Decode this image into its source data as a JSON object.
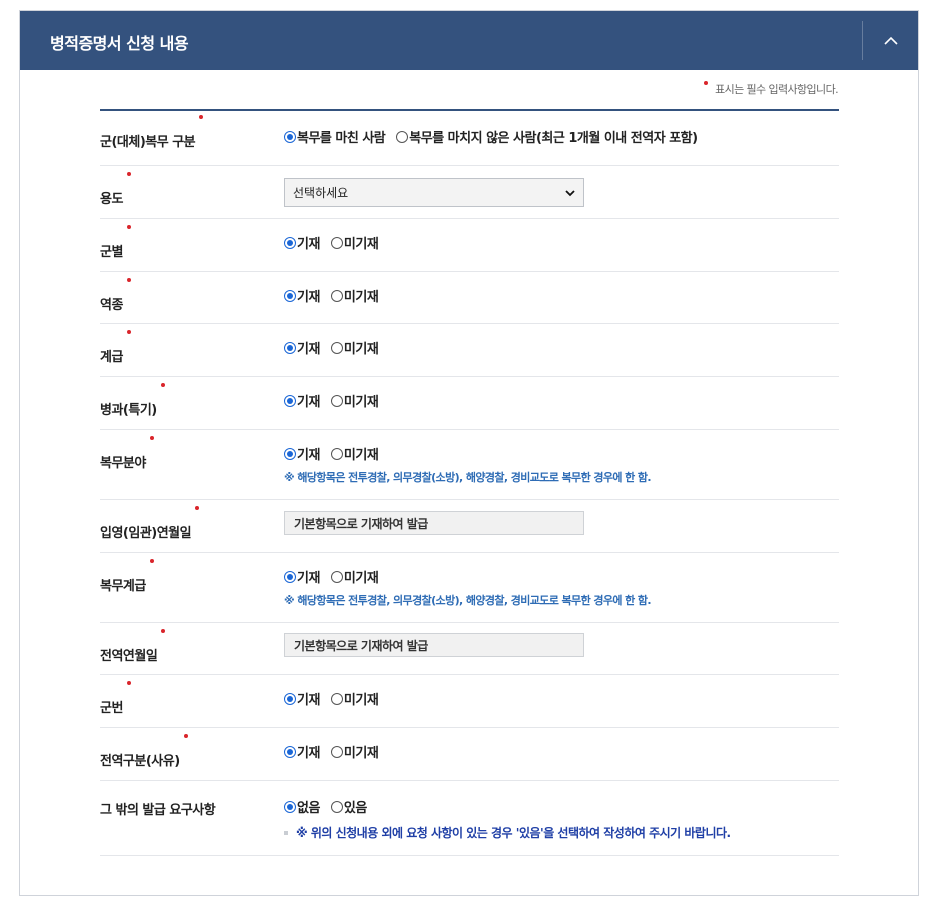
{
  "panel": {
    "title": "병적증명서 신청 내용",
    "collapse_icon": "chevron-up-icon"
  },
  "required_note": "표시는 필수 입력사항입니다.",
  "colors": {
    "header_bg": "#34527e",
    "required_dot": "#d9252b",
    "radio_checked": "#1a66d6",
    "hint": "#2e6cb5"
  },
  "rows": {
    "service_type": {
      "label": "군(대체)복무 구분",
      "opt1": "복무를 마친 사람",
      "opt2": "복무를 마치지 않은 사람(최근 1개월 이내 전역자 포함)"
    },
    "purpose": {
      "label": "용도",
      "select_value": "선택하세요"
    },
    "branch": {
      "label": "군별",
      "opt1": "기재",
      "opt2": "미기재"
    },
    "service_category": {
      "label": "역종",
      "opt1": "기재",
      "opt2": "미기재"
    },
    "rank": {
      "label": "계급",
      "opt1": "기재",
      "opt2": "미기재"
    },
    "specialty": {
      "label": "병과(특기)",
      "opt1": "기재",
      "opt2": "미기재"
    },
    "service_field": {
      "label": "복무분야",
      "opt1": "기재",
      "opt2": "미기재",
      "hint": "※ 해당항목은 전투경찰, 의무경찰(소방), 해양경찰, 경비교도로 복무한 경우에 한 함."
    },
    "enlist_date": {
      "label": "입영(임관)연월일",
      "value": "기본항목으로 기재하여 발급"
    },
    "service_rank": {
      "label": "복무계급",
      "opt1": "기재",
      "opt2": "미기재",
      "hint": "※ 해당항목은 전투경찰, 의무경찰(소방), 해양경찰, 경비교도로 복무한 경우에 한 함."
    },
    "discharge_date": {
      "label": "전역연월일",
      "value": "기본항목으로 기재하여 발급"
    },
    "service_number": {
      "label": "군번",
      "opt1": "기재",
      "opt2": "미기재"
    },
    "discharge_reason": {
      "label": "전역구분(사유)",
      "opt1": "기재",
      "opt2": "미기재"
    },
    "other_requests": {
      "label": "그 밖의 발급 요구사항",
      "opt1": "없음",
      "opt2": "있음",
      "hint": "※ 위의 신청내용 외에 요청 사항이 있는 경우 '있음'을 선택하여 작성하여 주시기 바랍니다."
    }
  }
}
